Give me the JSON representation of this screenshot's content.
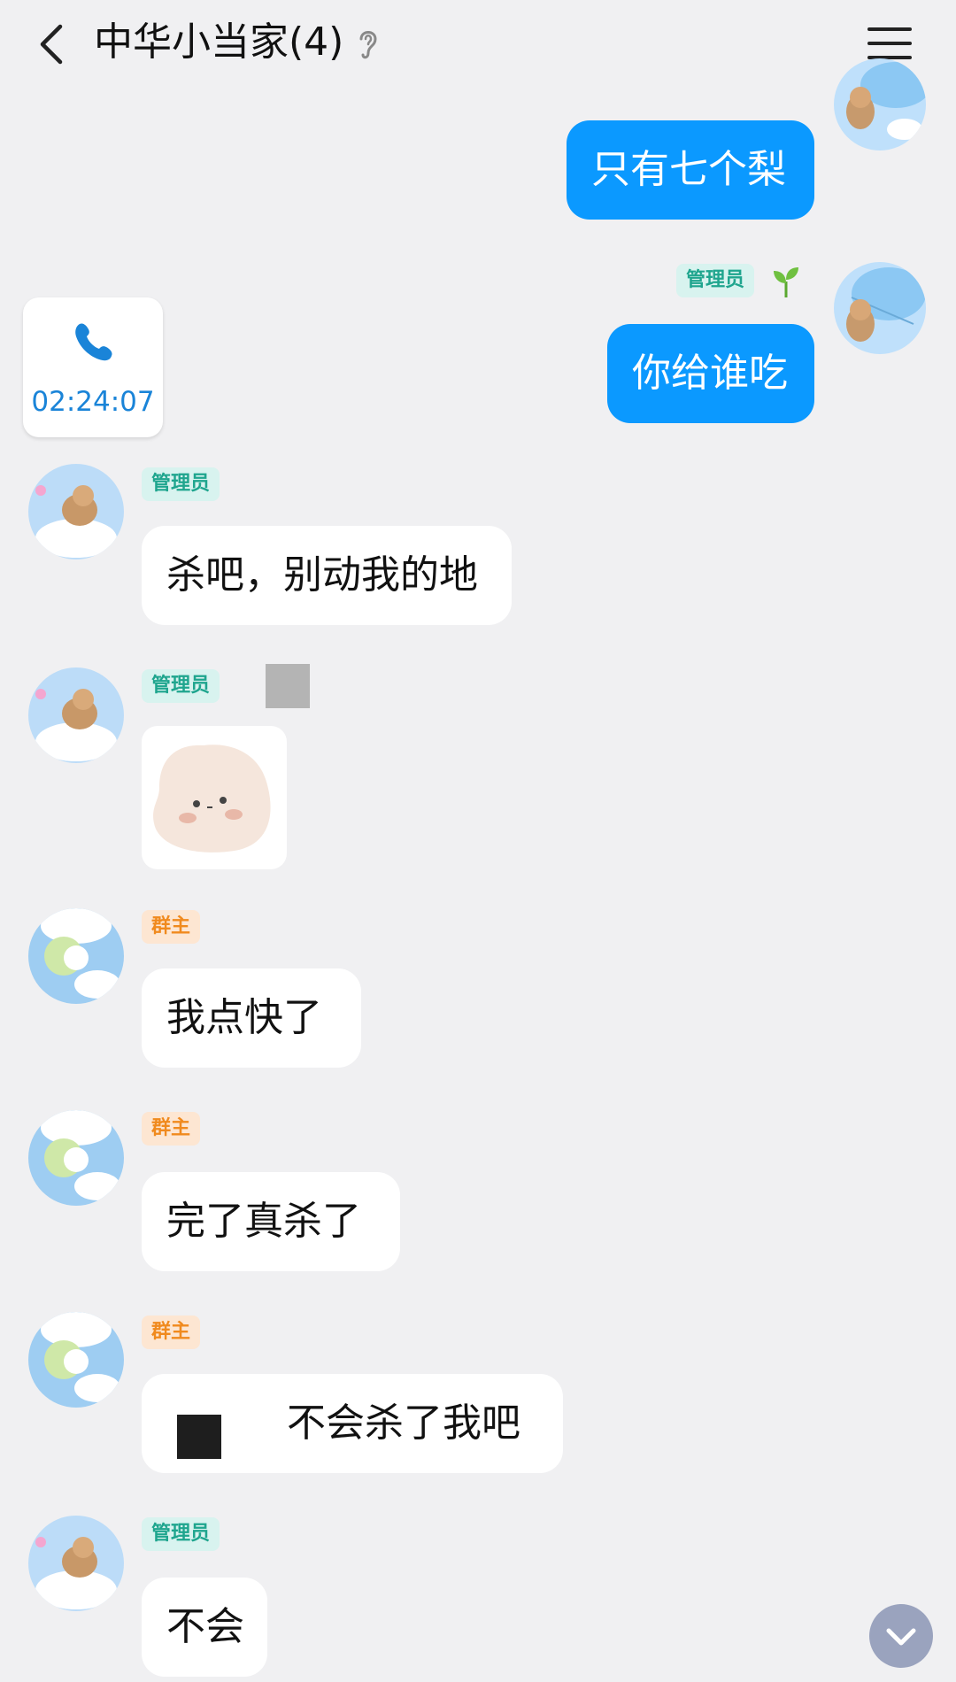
{
  "header": {
    "title": "中华小当家(4)"
  },
  "messages": [
    {
      "side": "out",
      "text": "只有七个梨"
    },
    {
      "side": "out",
      "badge": "管理员",
      "text": "你给谁吃"
    },
    {
      "side": "in",
      "type": "call",
      "duration": "02:24:07"
    },
    {
      "side": "in",
      "badge": "管理员",
      "text": "杀吧，别动我的地"
    },
    {
      "side": "in",
      "badge": "管理员",
      "type": "sticker"
    },
    {
      "side": "in",
      "badge": "群主",
      "text": "我点快了"
    },
    {
      "side": "in",
      "badge": "群主",
      "text": "完了真杀了"
    },
    {
      "side": "in",
      "badge": "群主",
      "text": "不会杀了我吧"
    },
    {
      "side": "in",
      "badge": "管理员",
      "text": "不会"
    }
  ],
  "colors": {
    "outgoing_bubble": "#0b99ff",
    "incoming_bubble": "#ffffff",
    "background": "#f0f0f2",
    "admin_badge_text": "#1fa58e",
    "owner_badge_text": "#f08a1e"
  },
  "icons": {
    "back": "chevron-left-icon",
    "ear": "ear-icon",
    "menu": "hamburger-menu-icon",
    "call": "phone-icon",
    "sprout": "sprout-icon",
    "scroll": "chevron-down-icon"
  }
}
